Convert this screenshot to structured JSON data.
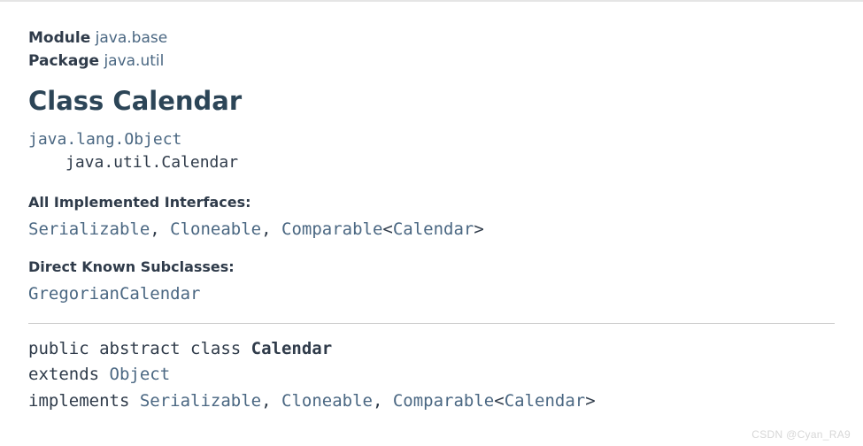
{
  "header": {
    "module_label": "Module",
    "module_link": "java.base",
    "package_label": "Package",
    "package_link": "java.util"
  },
  "title": "Class Calendar",
  "hierarchy": {
    "parent": "java.lang.Object",
    "self": "java.util.Calendar"
  },
  "interfaces": {
    "heading": "All Implemented Interfaces:",
    "items": [
      "Serializable",
      "Cloneable",
      "Comparable"
    ],
    "param": "Calendar",
    "sep": ", "
  },
  "subclasses": {
    "heading": "Direct Known Subclasses:",
    "items": [
      "GregorianCalendar"
    ]
  },
  "signature": {
    "line1_pre": "public abstract class ",
    "class_name": "Calendar",
    "line2_pre": "extends ",
    "extends_link": "Object",
    "line3_pre": "implements ",
    "impl": [
      "Serializable",
      "Cloneable",
      "Comparable"
    ],
    "impl_param": "Calendar",
    "sep": ", "
  },
  "watermark": "CSDN @Cyan_RA9"
}
